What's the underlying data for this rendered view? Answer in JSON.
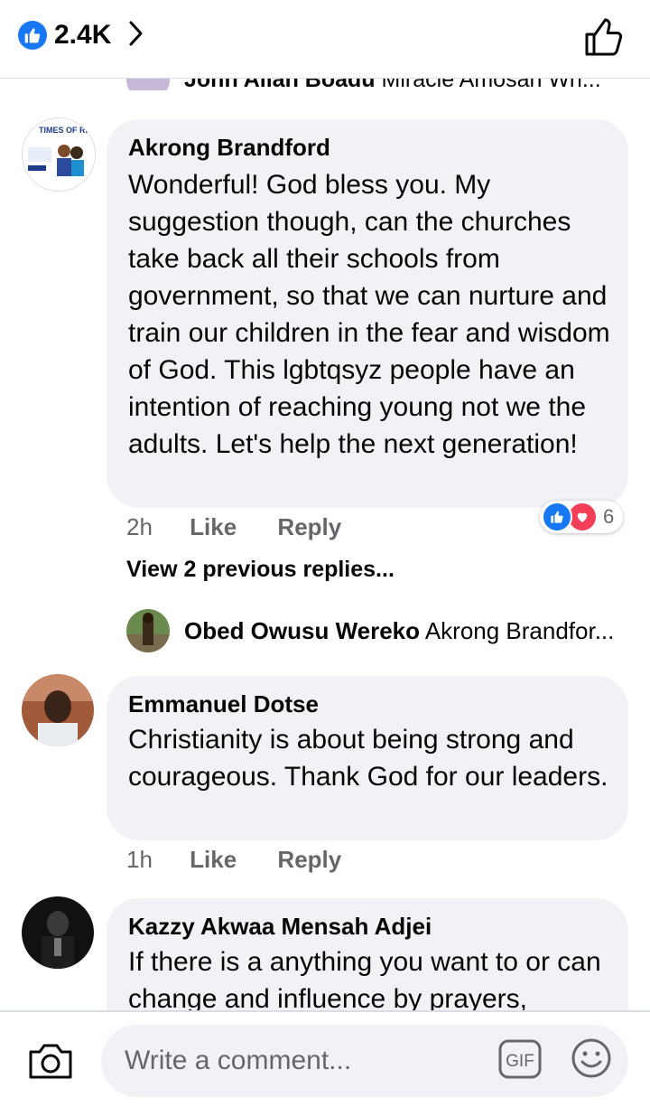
{
  "header": {
    "like_count": "2.4K",
    "icons": {
      "like_badge": "thumbs-up-icon",
      "chevron": "chevron-right-icon",
      "like_button": "thumbs-up-outline-icon"
    }
  },
  "clipped_reply": {
    "author": "John Allan Boadu",
    "snippet": "Miracle Amosah Wh..."
  },
  "comments": [
    {
      "author": "Akrong Brandford",
      "avatar_text": "TIMES OF REFRESHING",
      "text": "Wonderful! God bless you. My suggestion though, can the churches take back all their schools from government, so that we can nurture and train our children in the fear and wisdom of God. This lgbtqsyz people have an intention of reaching young not we the adults. Let's help the next generation!",
      "time": "2h",
      "like_label": "Like",
      "reply_label": "Reply",
      "reaction_count": "6",
      "reactions": [
        "like-reaction-icon",
        "love-reaction-icon"
      ]
    },
    {
      "author": "Emmanuel Dotse",
      "text": "Christianity is about being strong and courageous. Thank God for our leaders.",
      "time": "1h",
      "like_label": "Like",
      "reply_label": "Reply"
    },
    {
      "author": "Kazzy Akwaa Mensah Adjei",
      "text": "If there is a anything you want to or can change and influence by prayers,"
    }
  ],
  "view_replies": "View 2 previous replies...",
  "nested_reply": {
    "author": "Obed Owusu Wereko",
    "snippet": "Akrong Brandfor..."
  },
  "composer": {
    "placeholder": "Write a comment...",
    "gif_label": "GIF",
    "icons": {
      "camera": "camera-icon",
      "emoji": "emoji-icon"
    }
  },
  "colors": {
    "accent": "#1877f2",
    "love": "#f33e58",
    "bubble": "#f0f2f5",
    "secondary_text": "#65676b"
  }
}
